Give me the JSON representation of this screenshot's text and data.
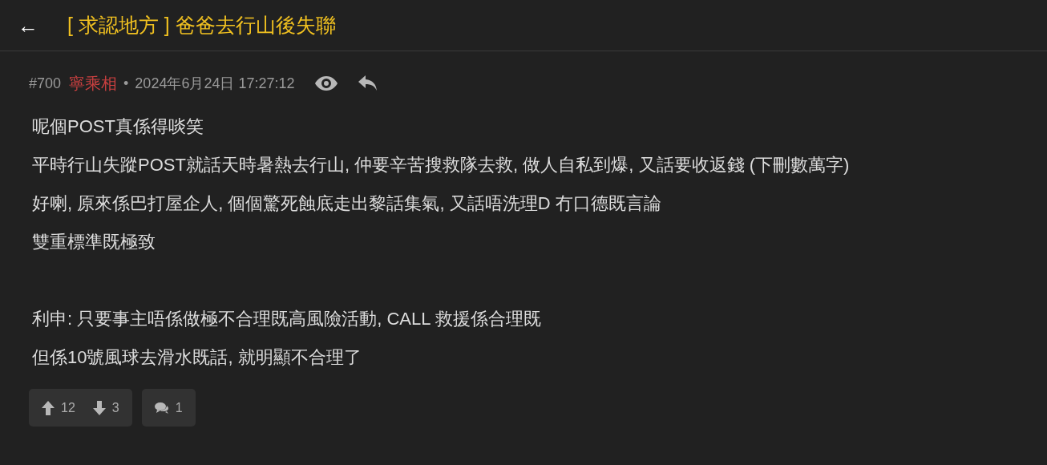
{
  "header": {
    "back": "←",
    "title": "[ 求認地方 ] 爸爸去行山後失聯"
  },
  "post": {
    "number": "#700",
    "author": "寧乘相",
    "separator": "•",
    "timestamp": "2024年6月24日 17:27:12",
    "paragraphs": [
      {
        "lines": [
          "呢個POST真係得啖笑",
          "平時行山失蹤POST就話天時暑熱去行山, 仲要辛苦搜救隊去救, 做人自私到爆, 又話要收返錢 (下刪數萬字)",
          "好喇, 原來係巴打屋企人, 個個驚死蝕底走出黎話集氣, 又話唔洗理D 冇口德既言論",
          "雙重標準既極致"
        ]
      },
      {
        "lines": [
          "利申: 只要事主唔係做極不合理既高風險活動, CALL 救援係合理既",
          "但係10號風球去滑水既話, 就明顯不合理了"
        ]
      }
    ],
    "votes": {
      "up": "12",
      "down": "3"
    },
    "replies": "1"
  }
}
